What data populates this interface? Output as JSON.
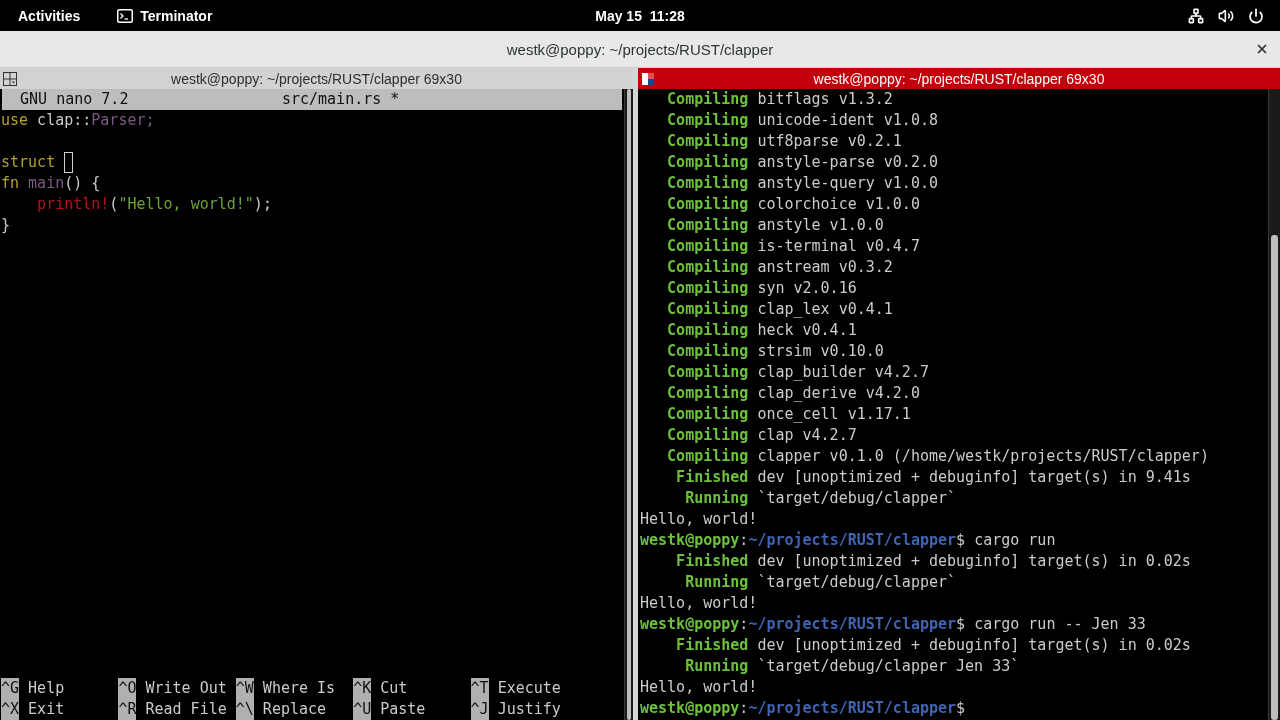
{
  "top_bar": {
    "activities": "Activities",
    "app_menu": "Terminator",
    "clock": "May 15  11:28"
  },
  "window": {
    "title": "westk@poppy: ~/projects/RUST/clapper"
  },
  "panes": [
    {
      "kind": "editor",
      "title": "westk@poppy: ~/projects/RUST/clapper 69x30",
      "focused": false,
      "editor": {
        "app": "GNU nano 7.2",
        "file": "src/main.rs *",
        "code": [
          {
            "kind": "code",
            "tokens": [
              {
                "kind": "keyword",
                "text": "use"
              },
              {
                "kind": "plain",
                "text": " clap::"
              },
              {
                "kind": "type",
                "text": "Parser;"
              }
            ]
          },
          {
            "kind": "blank"
          },
          {
            "kind": "code",
            "tokens": [
              {
                "kind": "keyword",
                "text": "struct"
              },
              {
                "kind": "cursor"
              }
            ]
          },
          {
            "kind": "code",
            "tokens": [
              {
                "kind": "keyword",
                "text": "fn "
              },
              {
                "kind": "function",
                "text": "main"
              },
              {
                "kind": "plain",
                "text": "() {"
              }
            ],
            "children": [
              {
                "kind": "code",
                "tokens": [
                  {
                    "kind": "macro",
                    "text": "println!"
                  },
                  {
                    "kind": "plain",
                    "text": "("
                  },
                  {
                    "kind": "string",
                    "text": "\"Hello, world!\""
                  },
                  {
                    "kind": "plain",
                    "text": ");"
                  }
                ]
              }
            ]
          },
          {
            "kind": "code",
            "tokens": [
              {
                "kind": "plain",
                "text": "}"
              }
            ]
          }
        ],
        "shortcuts": [
          {
            "key": "^G",
            "label": "Help"
          },
          {
            "key": "^O",
            "label": "Write Out"
          },
          {
            "key": "^W",
            "label": "Where Is"
          },
          {
            "key": "^K",
            "label": "Cut"
          },
          {
            "key": "^T",
            "label": "Execute"
          },
          {
            "key": "^X",
            "label": "Exit"
          },
          {
            "key": "^R",
            "label": "Read File"
          },
          {
            "key": "^\\",
            "label": "Replace"
          },
          {
            "key": "^U",
            "label": "Paste"
          },
          {
            "key": "^J",
            "label": "Justify"
          }
        ]
      }
    },
    {
      "kind": "shell",
      "title": "westk@poppy: ~/projects/RUST/clapper 69x30",
      "focused": true,
      "lines": [
        {
          "kind": "cargo",
          "status": "Compiling",
          "text": "bitflags v1.3.2"
        },
        {
          "kind": "cargo",
          "status": "Compiling",
          "text": "unicode-ident v1.0.8"
        },
        {
          "kind": "cargo",
          "status": "Compiling",
          "text": "utf8parse v0.2.1"
        },
        {
          "kind": "cargo",
          "status": "Compiling",
          "text": "anstyle-parse v0.2.0"
        },
        {
          "kind": "cargo",
          "status": "Compiling",
          "text": "anstyle-query v1.0.0"
        },
        {
          "kind": "cargo",
          "status": "Compiling",
          "text": "colorchoice v1.0.0"
        },
        {
          "kind": "cargo",
          "status": "Compiling",
          "text": "anstyle v1.0.0"
        },
        {
          "kind": "cargo",
          "status": "Compiling",
          "text": "is-terminal v0.4.7"
        },
        {
          "kind": "cargo",
          "status": "Compiling",
          "text": "anstream v0.3.2"
        },
        {
          "kind": "cargo",
          "status": "Compiling",
          "text": "syn v2.0.16"
        },
        {
          "kind": "cargo",
          "status": "Compiling",
          "text": "clap_lex v0.4.1"
        },
        {
          "kind": "cargo",
          "status": "Compiling",
          "text": "heck v0.4.1"
        },
        {
          "kind": "cargo",
          "status": "Compiling",
          "text": "strsim v0.10.0"
        },
        {
          "kind": "cargo",
          "status": "Compiling",
          "text": "clap_builder v4.2.7"
        },
        {
          "kind": "cargo",
          "status": "Compiling",
          "text": "clap_derive v4.2.0"
        },
        {
          "kind": "cargo",
          "status": "Compiling",
          "text": "once_cell v1.17.1"
        },
        {
          "kind": "cargo",
          "status": "Compiling",
          "text": "clap v4.2.7"
        },
        {
          "kind": "cargo",
          "status": "Compiling",
          "text": "clapper v0.1.0 (/home/westk/projects/RUST/clapper)"
        },
        {
          "kind": "cargo",
          "status": "Finished",
          "text": "dev [unoptimized + debuginfo] target(s) in 9.41s"
        },
        {
          "kind": "cargo",
          "status": "Running",
          "text": "`target/debug/clapper`"
        },
        {
          "kind": "output",
          "text": "Hello, world!"
        },
        {
          "kind": "prompt",
          "user": "westk@poppy",
          "separator": ":",
          "path": "~/projects/RUST/clapper",
          "symbol": "$",
          "command": "cargo run"
        },
        {
          "kind": "cargo",
          "status": "Finished",
          "text": "dev [unoptimized + debuginfo] target(s) in 0.02s"
        },
        {
          "kind": "cargo",
          "status": "Running",
          "text": "`target/debug/clapper`"
        },
        {
          "kind": "output",
          "text": "Hello, world!"
        },
        {
          "kind": "prompt",
          "user": "westk@poppy",
          "separator": ":",
          "path": "~/projects/RUST/clapper",
          "symbol": "$",
          "command": "cargo run -- Jen 33"
        },
        {
          "kind": "cargo",
          "status": "Finished",
          "text": "dev [unoptimized + debuginfo] target(s) in 0.02s"
        },
        {
          "kind": "cargo",
          "status": "Running",
          "text": "`target/debug/clapper Jen 33`"
        },
        {
          "kind": "output",
          "text": "Hello, world!"
        },
        {
          "kind": "prompt",
          "user": "westk@poppy",
          "separator": ":",
          "path": "~/projects/RUST/clapper",
          "symbol": "$"
        }
      ]
    }
  ]
}
